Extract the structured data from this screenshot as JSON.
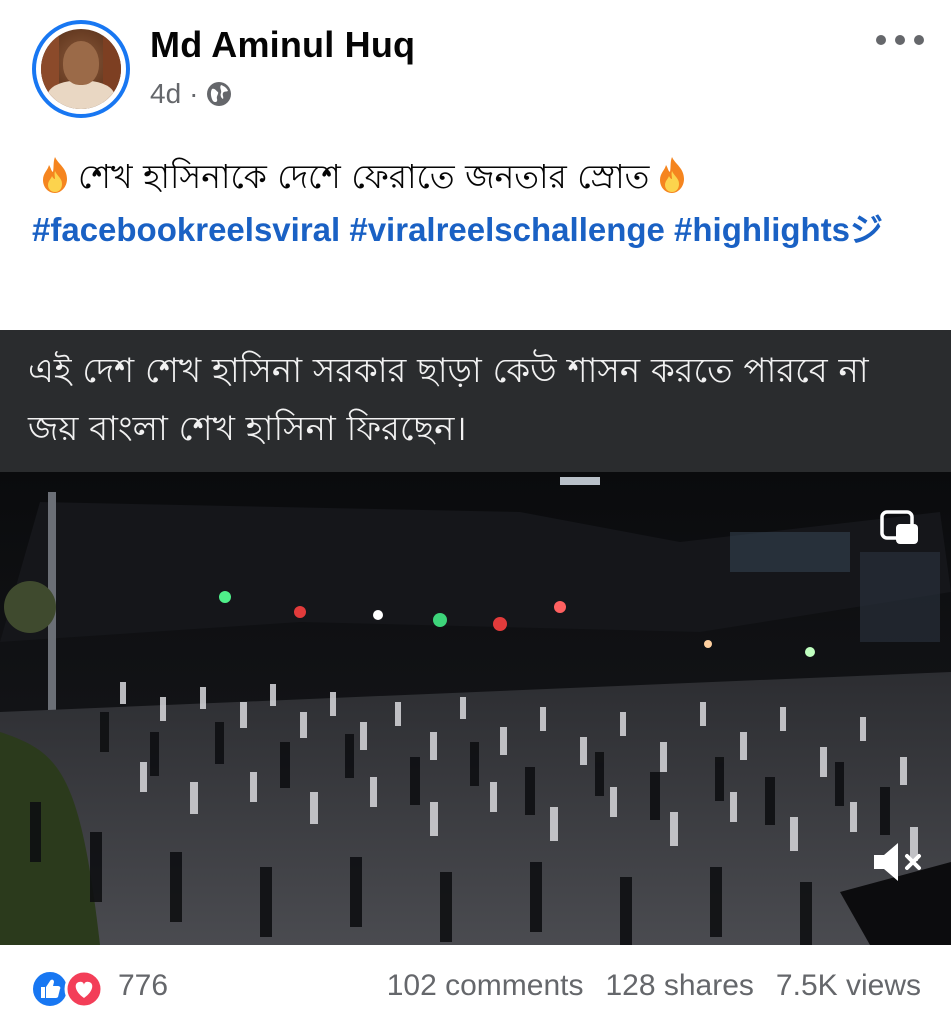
{
  "post": {
    "author": "Md Aminul Huq",
    "age": "4d",
    "separator": "·",
    "caption": "শেখ হাসিনাকে দেশে ফেরাতে জনতার স্রোত",
    "hashtags": "#facebookreelsviral #viralreelschallenge #highlightsジ"
  },
  "video": {
    "overlay_text": "এই দেশ শেখ হাসিনা সরকার ছাড়া কেউ শাসন করতে পারবে না জয় বাংলা শেখ হাসিনা ফিরছেন।",
    "muted": true
  },
  "engagement": {
    "reactions": "776",
    "comments": "102 comments",
    "shares": "128 shares",
    "views": "7.5K views"
  },
  "icons": {
    "privacy": "globe-icon",
    "menu": "more-icon",
    "pip": "picture-in-picture-icon",
    "sound": "muted-speaker-icon",
    "reactions": [
      "like-icon",
      "love-icon"
    ],
    "emoji": "fire-icon"
  },
  "colors": {
    "accent": "#1877f2",
    "hashtag": "#1a61c4",
    "secondary_text": "#65676b",
    "love": "#f33e58"
  }
}
